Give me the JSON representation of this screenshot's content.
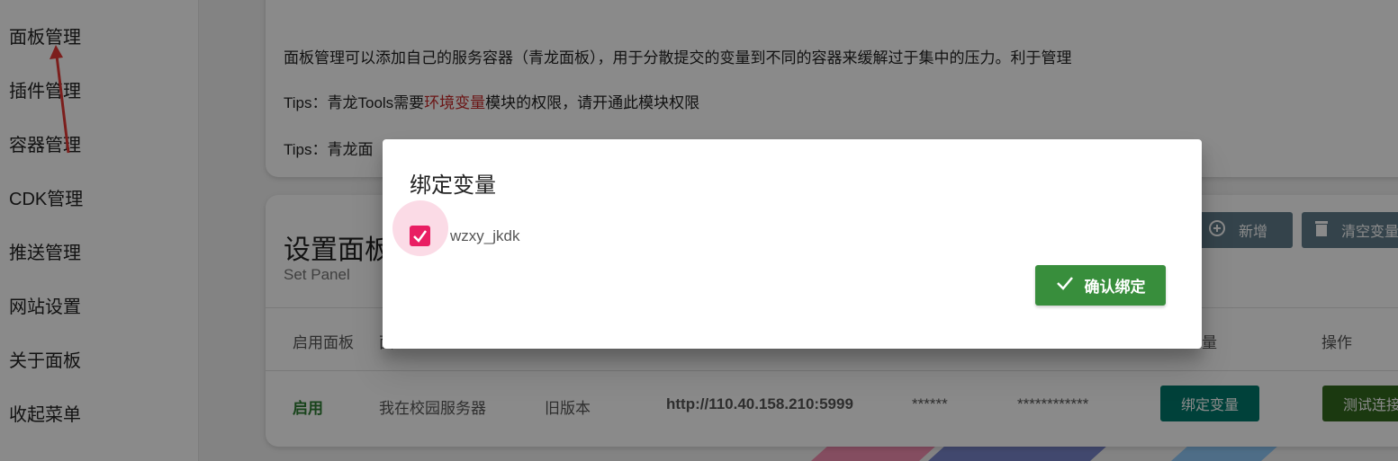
{
  "sidebar": {
    "items": [
      {
        "label": "面板管理"
      },
      {
        "label": "插件管理"
      },
      {
        "label": "容器管理"
      },
      {
        "label": "CDK管理"
      },
      {
        "label": "推送管理"
      },
      {
        "label": "网站设置"
      },
      {
        "label": "关于面板"
      },
      {
        "label": "收起菜单"
      }
    ]
  },
  "info": {
    "line1": "面板管理可以添加自己的服务容器（青龙面板），用于分散提交的变量到不同的容器来缓解过于集中的压力。利于管理",
    "line2_prefix": "Tips：青龙Tools需要",
    "line2_highlight": "环境变量",
    "line2_suffix": "模块的权限，请开通此模块权限",
    "line3": "Tips：青龙面"
  },
  "panel": {
    "title": "设置面板",
    "subtitle": "Set Panel",
    "add_label": "新增",
    "clear_label": "清空变量",
    "headers": [
      "启用面板",
      "面",
      "量",
      "操作"
    ],
    "row": {
      "status": "启用",
      "name": "我在校园服务器",
      "version": "旧版本",
      "url": "http://110.40.158.210:5999",
      "client_id": "******",
      "secret": "************",
      "bind_label": "绑定变量",
      "test_label": "测试连接"
    }
  },
  "dialog": {
    "title": "绑定变量",
    "checkbox_label": "wzxy_jkdk",
    "checked": true,
    "confirm_label": "确认绑定"
  },
  "colors": {
    "accent_pink": "#e91e63",
    "confirm_green": "#388e3c",
    "teal": "#00796b",
    "status_green": "#2e7d32",
    "highlight_red": "#c62828",
    "annotation_arrow": "#e53935"
  }
}
